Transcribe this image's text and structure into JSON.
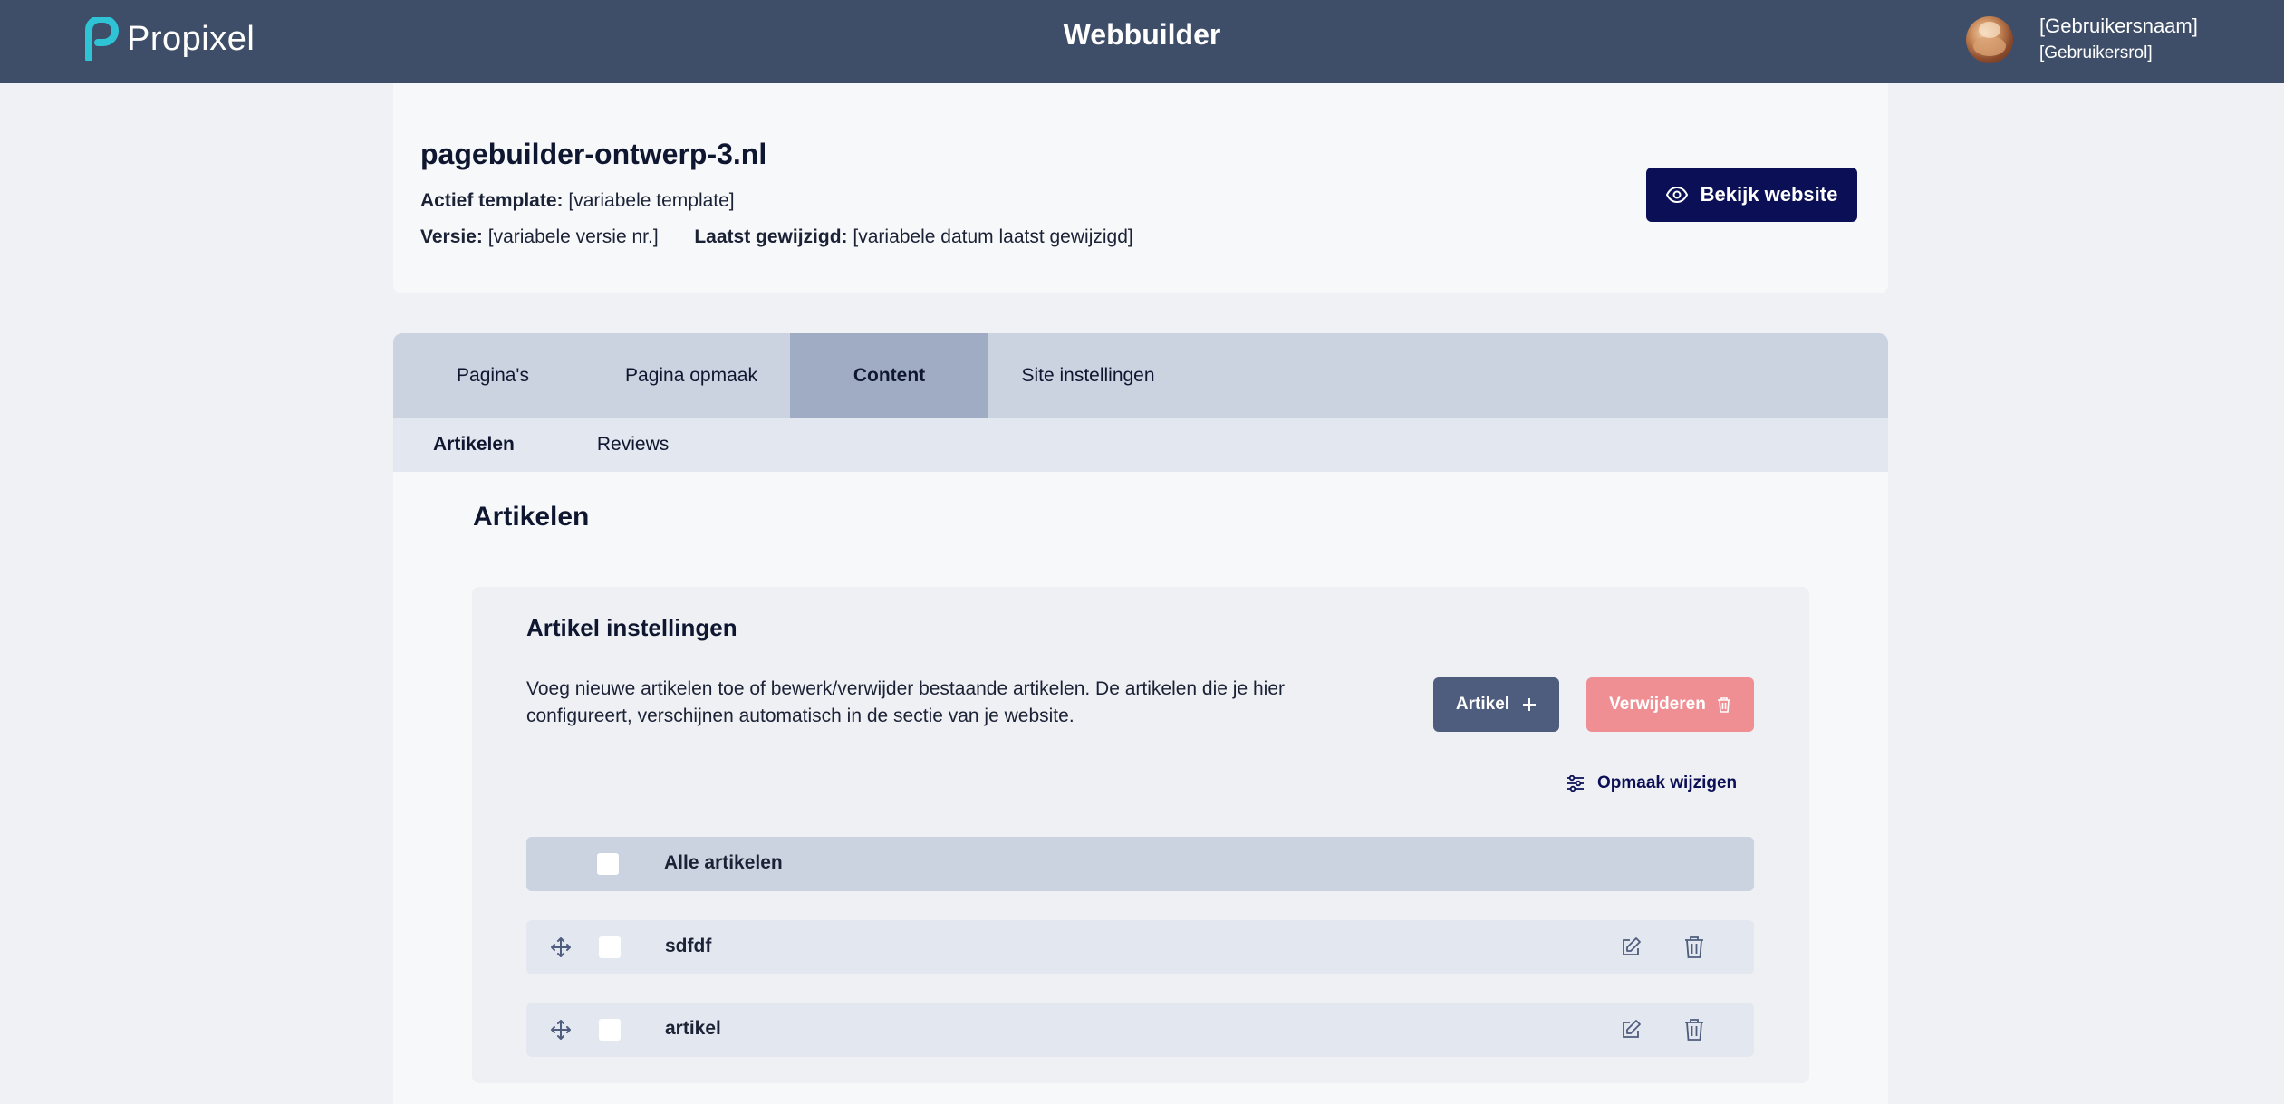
{
  "topbar": {
    "logo_text": "Propixel",
    "app_title": "Webbuilder",
    "user_name": "[Gebruikersnaam]",
    "user_role": "[Gebruikersrol]"
  },
  "site": {
    "name": "pagebuilder-ontwerp-3.nl",
    "template_label": "Actief template:",
    "template_value": "[variabele template]",
    "version_label": "Versie:",
    "version_value": "[variabele versie nr.]",
    "modified_label": "Laatst gewijzigd:",
    "modified_value": "[variabele datum laatst gewijzigd]",
    "view_button": "Bekijk website"
  },
  "tabs": {
    "main": [
      "Pagina's",
      "Pagina opmaak",
      "Content",
      "Site instellingen"
    ],
    "active_main": "Content",
    "sub": [
      "Artikelen",
      "Reviews"
    ],
    "active_sub": "Artikelen"
  },
  "content": {
    "section_title": "Artikelen",
    "settings_title": "Artikel instellingen",
    "description": "Voeg nieuwe artikelen toe of bewerk/verwijder bestaande artikelen. De artikelen die je hier configureert, verschijnen automatisch in de sectie van je website.",
    "add_button": "Artikel",
    "delete_button": "Verwijderen",
    "layout_link": "Opmaak wijzigen",
    "list_header": "Alle artikelen",
    "items": [
      {
        "title": "sdfdf"
      },
      {
        "title": "artikel"
      }
    ]
  },
  "colors": {
    "topbar": "#3f4e68",
    "primary": "#0b0f55",
    "active_tab": "#a0acc4",
    "danger": "#ef8f93",
    "logo_accent": "#2ec4d6"
  },
  "icons": [
    "eye-icon",
    "plus-icon",
    "trash-icon",
    "sliders-icon",
    "move-icon",
    "edit-icon"
  ]
}
